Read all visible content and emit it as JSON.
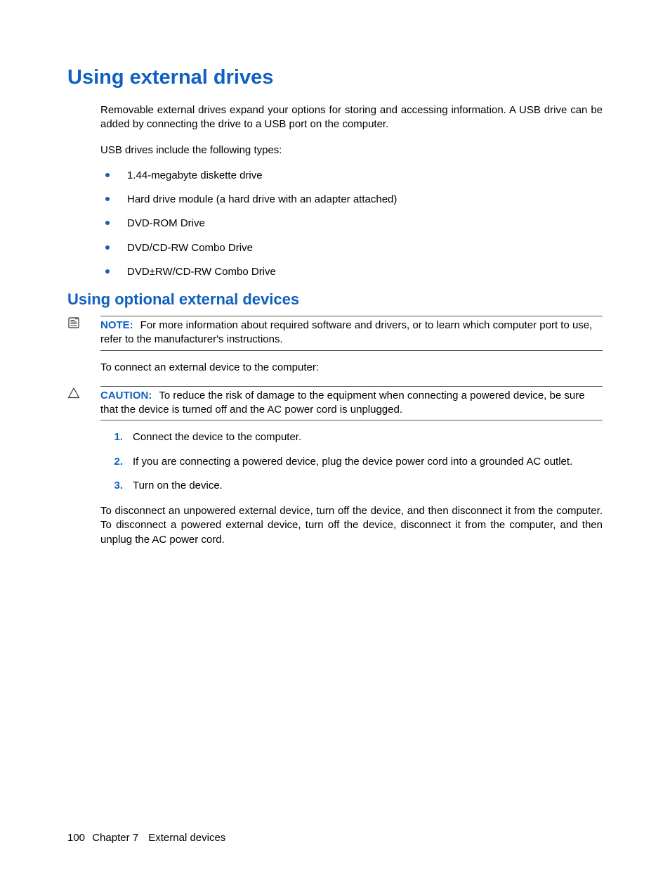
{
  "heading1": "Using external drives",
  "intro1": "Removable external drives expand your options for storing and accessing information. A USB drive can be added by connecting the drive to a USB port on the computer.",
  "intro2": "USB drives include the following types:",
  "bullets": [
    "1.44-megabyte diskette drive",
    "Hard drive module (a hard drive with an adapter attached)",
    "DVD-ROM Drive",
    "DVD/CD-RW Combo Drive",
    "DVD±RW/CD-RW Combo Drive"
  ],
  "heading2": "Using optional external devices",
  "note": {
    "label": "NOTE:",
    "text": "For more information about required software and drivers, or to learn which computer port to use, refer to the manufacturer's instructions."
  },
  "connect_intro": "To connect an external device to the computer:",
  "caution": {
    "label": "CAUTION:",
    "text": "To reduce the risk of damage to the equipment when connecting a powered device, be sure that the device is turned off and the AC power cord is unplugged."
  },
  "steps": [
    "Connect the device to the computer.",
    "If you are connecting a powered device, plug the device power cord into a grounded AC outlet.",
    "Turn on the device."
  ],
  "disconnect_para": "To disconnect an unpowered external device, turn off the device, and then disconnect it from the computer. To disconnect a powered external device, turn off the device, disconnect it from the computer, and then unplug the AC power cord.",
  "footer": {
    "page": "100",
    "chapter": "Chapter 7",
    "title": "External devices"
  }
}
